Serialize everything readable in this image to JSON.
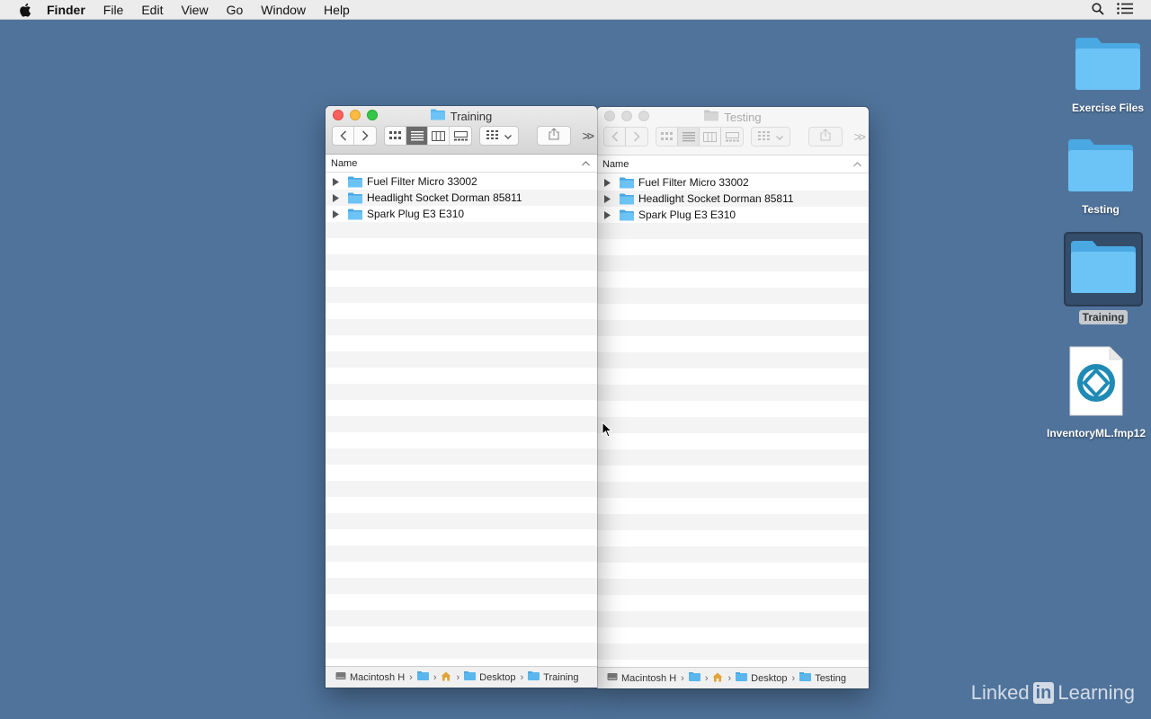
{
  "menubar": {
    "app": "Finder",
    "items": [
      "File",
      "Edit",
      "View",
      "Go",
      "Window",
      "Help"
    ]
  },
  "windows": {
    "training": {
      "title": "Training",
      "column_name": "Name",
      "rows": [
        "Fuel Filter Micro 33002",
        "Headlight Socket Dorman 85811",
        "Spark Plug E3 E310"
      ],
      "path": [
        "Macintosh H",
        "Desktop",
        "Training"
      ]
    },
    "testing": {
      "title": "Testing",
      "column_name": "Name",
      "rows": [
        "Fuel Filter Micro 33002",
        "Headlight Socket Dorman 85811",
        "Spark Plug E3 E310"
      ],
      "path": [
        "Macintosh H",
        "Desktop",
        "Testing"
      ]
    }
  },
  "desktop": {
    "icons": [
      {
        "label": "Exercise Files",
        "icon": "folder-icon"
      },
      {
        "label": "Testing",
        "icon": "folder-icon"
      },
      {
        "label": "Training",
        "icon": "folder-icon",
        "selected": true
      },
      {
        "label": "InventoryML.fmp12",
        "icon": "filemaker-document-icon"
      }
    ]
  },
  "watermark": {
    "linked": "Linked",
    "in": "in",
    "learning": "Learning"
  },
  "colors": {
    "desktop": "#4f739b",
    "folder": "#5ab6ec",
    "accent_close": "#fc605c",
    "accent_min": "#fdbc40",
    "accent_max": "#34c84a"
  }
}
